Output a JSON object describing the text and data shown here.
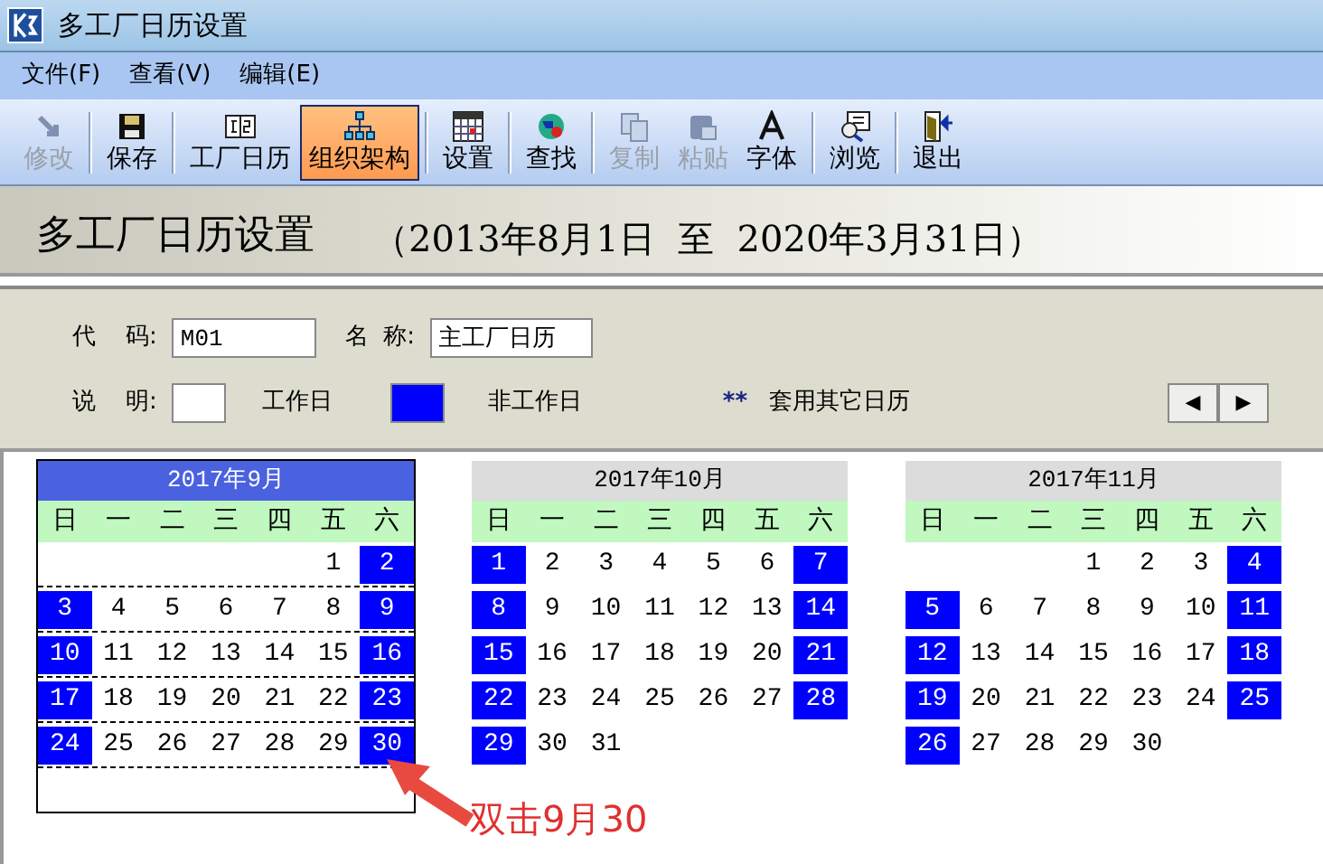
{
  "window": {
    "title": "多工厂日历设置"
  },
  "menu": [
    {
      "label": "文件(F)"
    },
    {
      "label": "查看(V)"
    },
    {
      "label": "编辑(E)"
    }
  ],
  "toolbar": [
    {
      "label": "修改",
      "disabled": true,
      "selected": false
    },
    {
      "label": "保存",
      "disabled": false,
      "selected": false
    },
    {
      "label": "工厂日历",
      "disabled": false,
      "selected": false
    },
    {
      "label": "组织架构",
      "disabled": false,
      "selected": true
    },
    {
      "label": "设置",
      "disabled": false,
      "selected": false
    },
    {
      "label": "查找",
      "disabled": false,
      "selected": false
    },
    {
      "label": "复制",
      "disabled": true,
      "selected": false
    },
    {
      "label": "粘贴",
      "disabled": true,
      "selected": false
    },
    {
      "label": "字体",
      "disabled": false,
      "selected": false
    },
    {
      "label": "浏览",
      "disabled": false,
      "selected": false
    },
    {
      "label": "退出",
      "disabled": false,
      "selected": false
    }
  ],
  "banner": {
    "title": "多工厂日历设置",
    "range": "（2013年8月1日  至  2020年3月31日）"
  },
  "form": {
    "code_label": "代    码:",
    "code_value": "M01",
    "name_label": "名  称:",
    "name_value": "主工厂日历",
    "legend_label": "说    明:",
    "work_label": "工作日",
    "off_label": "非工作日",
    "other_mark": "**",
    "other_label": "套用其它日历",
    "prev": "◀",
    "next": "▶"
  },
  "months": [
    {
      "title": "2017年9月",
      "selected": true,
      "weekdays": [
        "日",
        "一",
        "二",
        "三",
        "四",
        "五",
        "六"
      ],
      "weeks": [
        {
          "fri": {
            "day": "1",
            "off": false
          },
          "sat": {
            "day": "2",
            "off": true
          }
        },
        {
          "sun": {
            "day": "3",
            "off": true
          },
          "mon": {
            "day": "4",
            "off": false
          },
          "tue": {
            "day": "5",
            "off": false
          },
          "wed": {
            "day": "6",
            "off": false
          },
          "thu": {
            "day": "7",
            "off": false
          },
          "fri": {
            "day": "8",
            "off": false
          },
          "sat": {
            "day": "9",
            "off": true
          }
        },
        {
          "sun": {
            "day": "10",
            "off": true
          },
          "mon": {
            "day": "11",
            "off": false
          },
          "tue": {
            "day": "12",
            "off": false
          },
          "wed": {
            "day": "13",
            "off": false
          },
          "thu": {
            "day": "14",
            "off": false
          },
          "fri": {
            "day": "15",
            "off": false
          },
          "sat": {
            "day": "16",
            "off": true
          }
        },
        {
          "sun": {
            "day": "17",
            "off": true
          },
          "mon": {
            "day": "18",
            "off": false
          },
          "tue": {
            "day": "19",
            "off": false
          },
          "wed": {
            "day": "20",
            "off": false
          },
          "thu": {
            "day": "21",
            "off": false
          },
          "fri": {
            "day": "22",
            "off": false
          },
          "sat": {
            "day": "23",
            "off": true
          }
        },
        {
          "sun": {
            "day": "24",
            "off": true
          },
          "mon": {
            "day": "25",
            "off": false
          },
          "tue": {
            "day": "26",
            "off": false
          },
          "wed": {
            "day": "27",
            "off": false
          },
          "thu": {
            "day": "28",
            "off": false
          },
          "fri": {
            "day": "29",
            "off": false
          },
          "sat": {
            "day": "30",
            "off": true
          }
        }
      ]
    },
    {
      "title": "2017年10月",
      "selected": false,
      "weekdays": [
        "日",
        "一",
        "二",
        "三",
        "四",
        "五",
        "六"
      ],
      "weeks": [
        {
          "sun": {
            "day": "1",
            "off": true
          },
          "mon": {
            "day": "2",
            "off": false
          },
          "tue": {
            "day": "3",
            "off": false
          },
          "wed": {
            "day": "4",
            "off": false
          },
          "thu": {
            "day": "5",
            "off": false
          },
          "fri": {
            "day": "6",
            "off": false
          },
          "sat": {
            "day": "7",
            "off": true
          }
        },
        {
          "sun": {
            "day": "8",
            "off": true
          },
          "mon": {
            "day": "9",
            "off": false
          },
          "tue": {
            "day": "10",
            "off": false
          },
          "wed": {
            "day": "11",
            "off": false
          },
          "thu": {
            "day": "12",
            "off": false
          },
          "fri": {
            "day": "13",
            "off": false
          },
          "sat": {
            "day": "14",
            "off": true
          }
        },
        {
          "sun": {
            "day": "15",
            "off": true
          },
          "mon": {
            "day": "16",
            "off": false
          },
          "tue": {
            "day": "17",
            "off": false
          },
          "wed": {
            "day": "18",
            "off": false
          },
          "thu": {
            "day": "19",
            "off": false
          },
          "fri": {
            "day": "20",
            "off": false
          },
          "sat": {
            "day": "21",
            "off": true
          }
        },
        {
          "sun": {
            "day": "22",
            "off": true
          },
          "mon": {
            "day": "23",
            "off": false
          },
          "tue": {
            "day": "24",
            "off": false
          },
          "wed": {
            "day": "25",
            "off": false
          },
          "thu": {
            "day": "26",
            "off": false
          },
          "fri": {
            "day": "27",
            "off": false
          },
          "sat": {
            "day": "28",
            "off": true
          }
        },
        {
          "sun": {
            "day": "29",
            "off": true
          },
          "mon": {
            "day": "30",
            "off": false
          },
          "tue": {
            "day": "31",
            "off": false
          }
        }
      ]
    },
    {
      "title": "2017年11月",
      "selected": false,
      "weekdays": [
        "日",
        "一",
        "二",
        "三",
        "四",
        "五",
        "六"
      ],
      "weeks": [
        {
          "wed": {
            "day": "1",
            "off": false
          },
          "thu": {
            "day": "2",
            "off": false
          },
          "fri": {
            "day": "3",
            "off": false
          },
          "sat": {
            "day": "4",
            "off": true
          }
        },
        {
          "sun": {
            "day": "5",
            "off": true
          },
          "mon": {
            "day": "6",
            "off": false
          },
          "tue": {
            "day": "7",
            "off": false
          },
          "wed": {
            "day": "8",
            "off": false
          },
          "thu": {
            "day": "9",
            "off": false
          },
          "fri": {
            "day": "10",
            "off": false
          },
          "sat": {
            "day": "11",
            "off": true
          }
        },
        {
          "sun": {
            "day": "12",
            "off": true
          },
          "mon": {
            "day": "13",
            "off": false
          },
          "tue": {
            "day": "14",
            "off": false
          },
          "wed": {
            "day": "15",
            "off": false
          },
          "thu": {
            "day": "16",
            "off": false
          },
          "fri": {
            "day": "17",
            "off": false
          },
          "sat": {
            "day": "18",
            "off": true
          }
        },
        {
          "sun": {
            "day": "19",
            "off": true
          },
          "mon": {
            "day": "20",
            "off": false
          },
          "tue": {
            "day": "21",
            "off": false
          },
          "wed": {
            "day": "22",
            "off": false
          },
          "thu": {
            "day": "23",
            "off": false
          },
          "fri": {
            "day": "24",
            "off": false
          },
          "sat": {
            "day": "25",
            "off": true
          }
        },
        {
          "sun": {
            "day": "26",
            "off": true
          },
          "mon": {
            "day": "27",
            "off": false
          },
          "tue": {
            "day": "28",
            "off": false
          },
          "wed": {
            "day": "29",
            "off": false
          },
          "thu": {
            "day": "30",
            "off": false
          }
        }
      ]
    }
  ],
  "annotation": {
    "text": "双击9月30"
  }
}
